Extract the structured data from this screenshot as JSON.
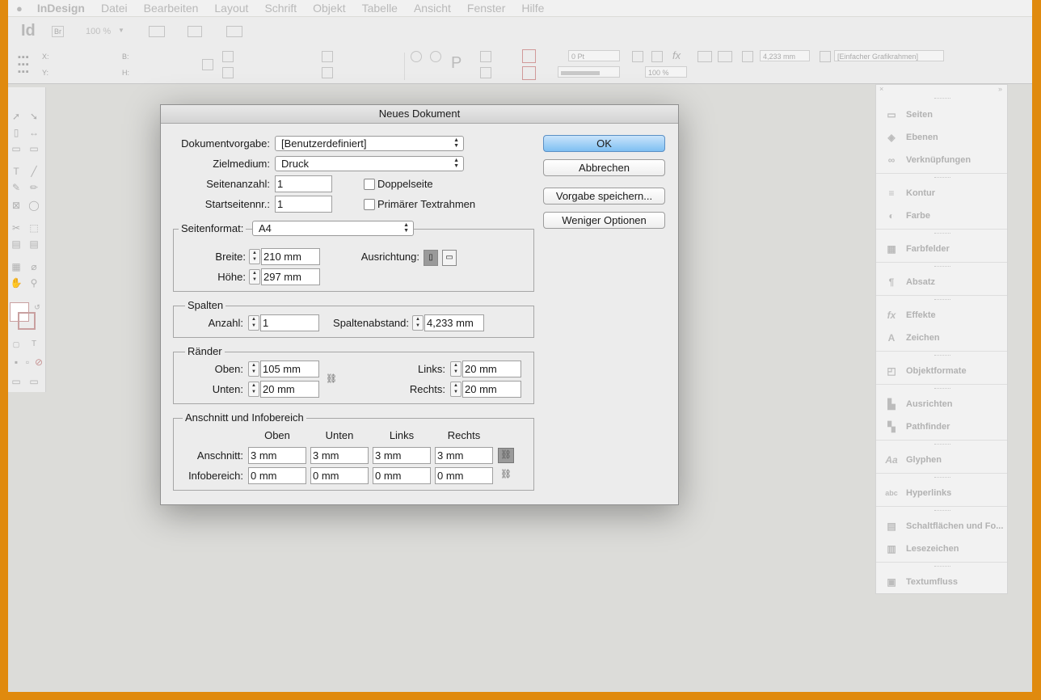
{
  "menubar": {
    "app": "InDesign",
    "items": [
      "Datei",
      "Bearbeiten",
      "Layout",
      "Schrift",
      "Objekt",
      "Tabelle",
      "Ansicht",
      "Fenster",
      "Hilfe"
    ]
  },
  "toolbar": {
    "logo": "Id",
    "bridge": "Br",
    "zoom": "100 %",
    "x_label": "X:",
    "y_label": "Y:",
    "b_label": "B:",
    "h_label": "H:",
    "stroke_weight": "0 Pt",
    "opacity": "100 %",
    "gap_value": "4,233 mm",
    "frame_style": "[Einfacher Grafikrahmen]"
  },
  "dialog": {
    "title": "Neues Dokument",
    "dokumentvorgabe_label": "Dokumentvorgabe:",
    "dokumentvorgabe_value": "[Benutzerdefiniert]",
    "zielmedium_label": "Zielmedium:",
    "zielmedium_value": "Druck",
    "seitenanzahl_label": "Seitenanzahl:",
    "seitenanzahl_value": "1",
    "startseite_label": "Startseitennr.:",
    "startseite_value": "1",
    "doppelseite_label": "Doppelseite",
    "textrahmen_label": "Primärer Textrahmen",
    "seitenformat_label": "Seitenformat:",
    "seitenformat_value": "A4",
    "breite_label": "Breite:",
    "breite_value": "210 mm",
    "hoehe_label": "Höhe:",
    "hoehe_value": "297 mm",
    "ausrichtung_label": "Ausrichtung:",
    "spalten_title": "Spalten",
    "anzahl_label": "Anzahl:",
    "anzahl_value": "1",
    "spaltenabstand_label": "Spaltenabstand:",
    "spaltenabstand_value": "4,233 mm",
    "raender_title": "Ränder",
    "oben_label": "Oben:",
    "oben_value": "105 mm",
    "unten_label": "Unten:",
    "unten_value": "20 mm",
    "links_label": "Links:",
    "links_value": "20 mm",
    "rechts_label": "Rechts:",
    "rechts_value": "20 mm",
    "anschnitt_title": "Anschnitt und Infobereich",
    "col_oben": "Oben",
    "col_unten": "Unten",
    "col_links": "Links",
    "col_rechts": "Rechts",
    "anschnitt_label": "Anschnitt:",
    "anschnitt_values": [
      "3 mm",
      "3 mm",
      "3 mm",
      "3 mm"
    ],
    "infobereich_label": "Infobereich:",
    "infobereich_values": [
      "0 mm",
      "0 mm",
      "0 mm",
      "0 mm"
    ],
    "buttons": {
      "ok": "OK",
      "abbrechen": "Abbrechen",
      "vorgabe": "Vorgabe speichern...",
      "weniger": "Weniger Optionen"
    }
  },
  "panels": [
    {
      "label": "Seiten",
      "icon": "pages-icon"
    },
    {
      "label": "Ebenen",
      "icon": "layers-icon"
    },
    {
      "label": "Verknüpfungen",
      "icon": "links-icon"
    },
    {
      "label": "Kontur",
      "icon": "stroke-icon"
    },
    {
      "label": "Farbe",
      "icon": "color-icon"
    },
    {
      "label": "Farbfelder",
      "icon": "swatches-icon"
    },
    {
      "label": "Absatz",
      "icon": "paragraph-icon"
    },
    {
      "label": "Effekte",
      "icon": "effects-icon"
    },
    {
      "label": "Zeichen",
      "icon": "character-icon"
    },
    {
      "label": "Objektformate",
      "icon": "object-styles-icon"
    },
    {
      "label": "Ausrichten",
      "icon": "align-icon"
    },
    {
      "label": "Pathfinder",
      "icon": "pathfinder-icon"
    },
    {
      "label": "Glyphen",
      "icon": "glyphs-icon"
    },
    {
      "label": "Hyperlinks",
      "icon": "hyperlinks-icon"
    },
    {
      "label": "Schaltflächen und Fo...",
      "icon": "buttons-forms-icon"
    },
    {
      "label": "Lesezeichen",
      "icon": "bookmarks-icon"
    },
    {
      "label": "Textumfluss",
      "icon": "text-wrap-icon"
    }
  ]
}
